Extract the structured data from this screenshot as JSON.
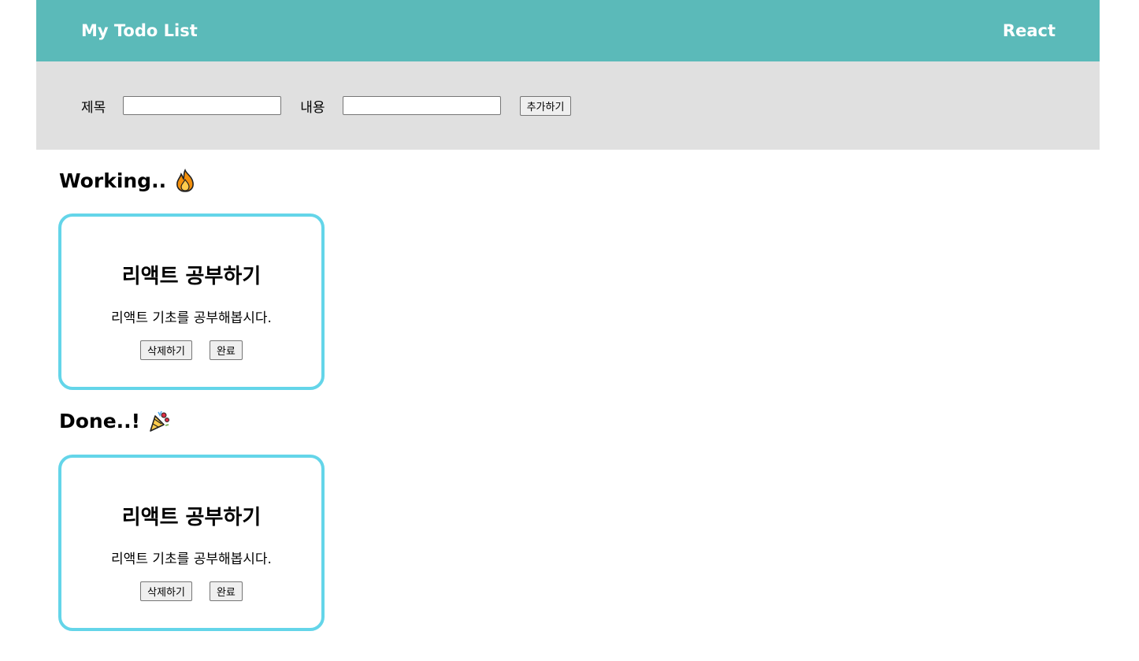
{
  "header": {
    "title": "My Todo List",
    "right_label": "React"
  },
  "form": {
    "title_label": "제목",
    "title_value": "",
    "content_label": "내용",
    "content_value": "",
    "add_button": "추가하기"
  },
  "working": {
    "heading": "Working..",
    "icon": "fire-icon",
    "cards": [
      {
        "title": "리액트 공부하기",
        "body": "리액트 기초를 공부해봅시다.",
        "delete_label": "삭제하기",
        "complete_label": "완료"
      }
    ]
  },
  "done": {
    "heading": "Done..!",
    "icon": "party-popper-icon",
    "cards": [
      {
        "title": "리액트 공부하기",
        "body": "리액트 기초를 공부해봅시다.",
        "delete_label": "삭제하기",
        "complete_label": "완료"
      }
    ]
  },
  "colors": {
    "header_bg": "#5bbab9",
    "form_bg": "#e0e0e0",
    "card_border": "#64d5e9"
  }
}
